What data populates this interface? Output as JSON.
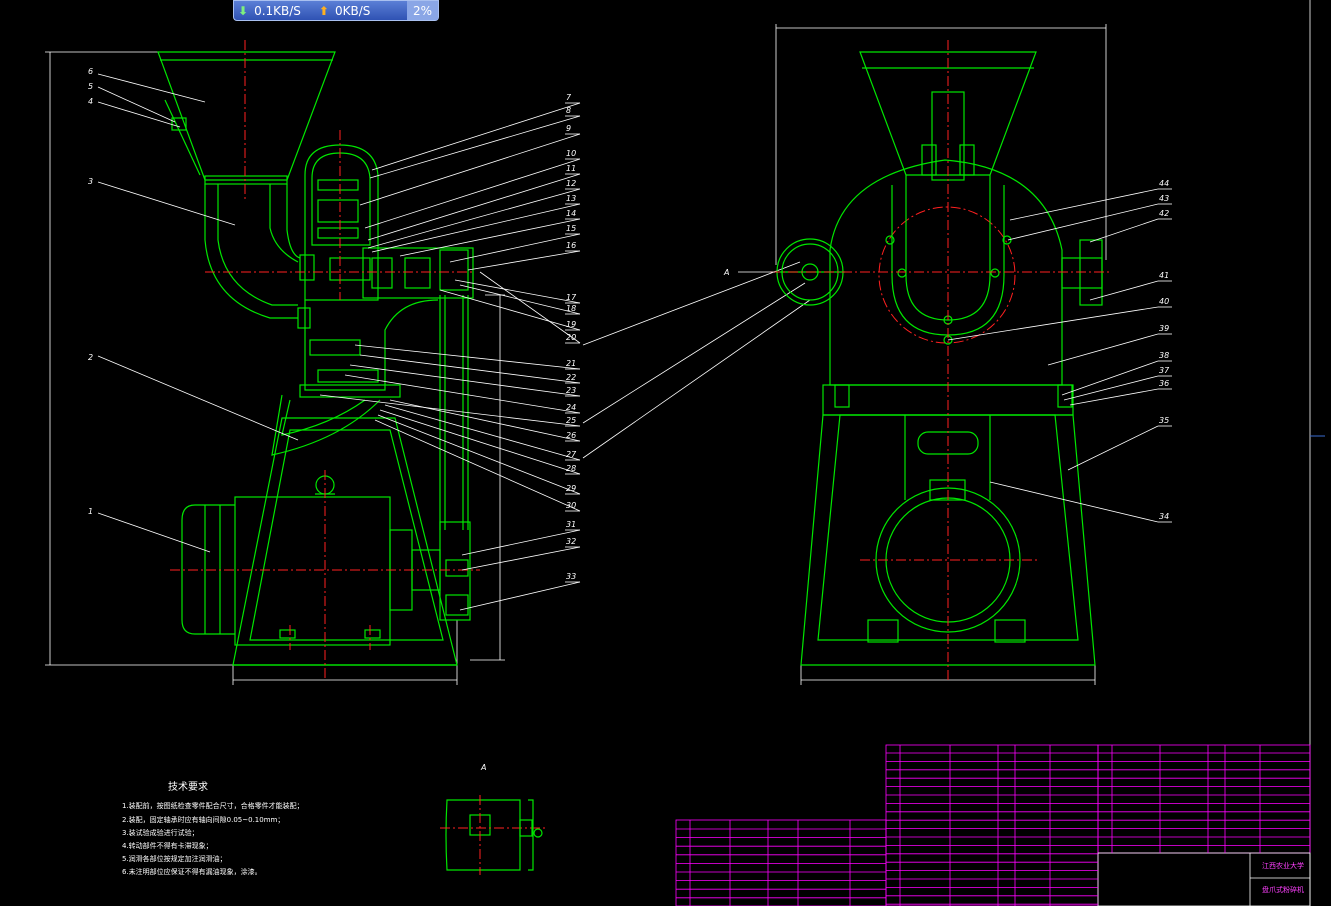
{
  "network_widget": {
    "download": "0.1KB/S",
    "upload": "0KB/S",
    "usage": "2%",
    "download_icon": "arrow-down-icon",
    "upload_icon": "arrow-up-icon"
  },
  "colors": {
    "background": "#000000",
    "lines": "#00e600",
    "centerlines": "#ff2020",
    "leaders": "#ffffff",
    "table": "#ff00ff"
  },
  "drawing": {
    "left_labels": [
      "6",
      "5",
      "4",
      "3",
      "2",
      "1"
    ],
    "mid_labels": [
      "7",
      "8",
      "9",
      "10",
      "11",
      "12",
      "13",
      "14",
      "15",
      "16",
      "17",
      "18",
      "19",
      "20",
      "21",
      "22",
      "23",
      "24",
      "25",
      "26",
      "27",
      "28",
      "29",
      "30",
      "31",
      "32",
      "33"
    ],
    "right_labels": [
      "44",
      "43",
      "42",
      "41",
      "40",
      "39",
      "38",
      "37",
      "36",
      "35",
      "34"
    ],
    "view_mark": "A",
    "detail_mark": "A",
    "notes_title": "技术要求",
    "notes": [
      "1.装配前，按图纸检查零件配合尺寸，合格零件才能装配；",
      "2.装配，固定轴承时应有轴向间隙0.05~0.10mm；",
      "3.装试验成验进行试验；",
      "4.转动部件不得有卡滞现象；",
      "5.润滑各部位按规定加注润滑油；",
      "6.未注明部位应保证不得有漏油现象，涂漆。"
    ],
    "title_school": "江西农业大学",
    "title_name": "盘爪式粉碎机"
  }
}
